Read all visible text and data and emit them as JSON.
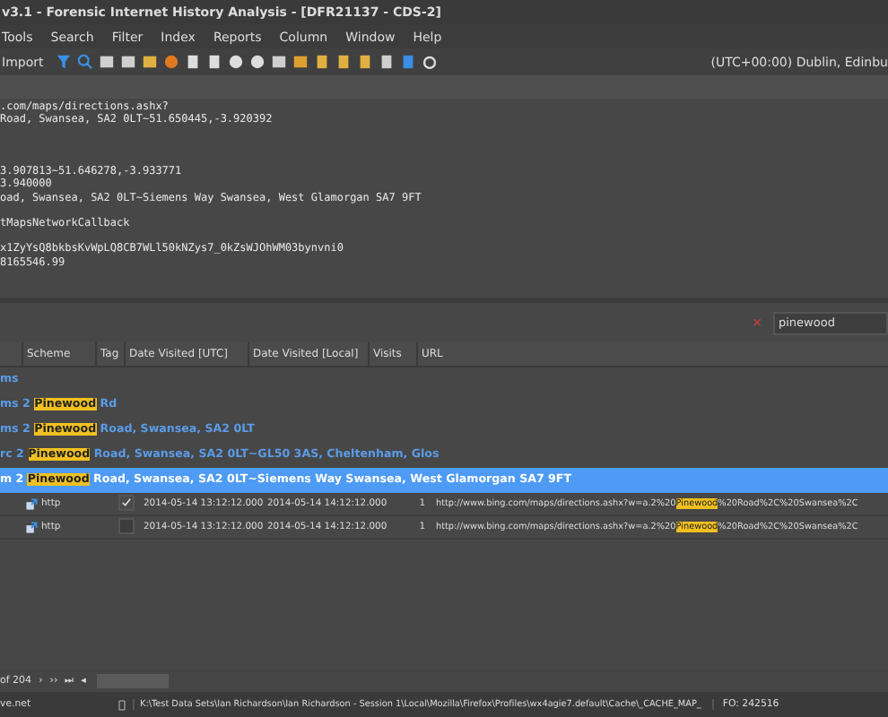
{
  "window": {
    "title": "v3.1 - Forensic Internet History Analysis - [DFR21137 - CDS-2]"
  },
  "menu": [
    "Tools",
    "Search",
    "Filter",
    "Index",
    "Reports",
    "Column",
    "Window",
    "Help"
  ],
  "toolbar": {
    "import_label": "Import",
    "timezone": "(UTC+00:00) Dublin, Edinbu"
  },
  "detail_blocks": [
    [
      ".com/maps/directions.ashx?",
      "Road, Swansea, SA2 0LT~51.650445,-3.920392"
    ],
    [
      "3.907813~51.646278,-3.933771",
      "3.940000",
      "oad, Swansea, SA2 0LT~Siemens Way Swansea, West Glamorgan SA7 9FT"
    ],
    [
      "tMapsNetworkCallback"
    ],
    [
      "x1ZyYsQ8bkbsKvWpLQ8CB7WLl50kNZys7_0kZsWJOhWM03bynvni0",
      "8165546.99"
    ]
  ],
  "search": {
    "clear": "×",
    "value": "pinewood"
  },
  "table": {
    "columns": [
      "Scheme",
      "Tag",
      "Date Visited [UTC]",
      "Date Visited [Local]",
      "Visits",
      "URL"
    ],
    "groups": [
      {
        "prefix": "ms",
        "selected": false
      },
      {
        "prefix": "ms 2 ",
        "match": "Pinewood",
        "rest": " Rd",
        "selected": false
      },
      {
        "prefix": "ms 2 ",
        "match": "Pinewood",
        "rest": " Road, Swansea, SA2 0LT",
        "selected": false
      },
      {
        "prefix": "rc 2 ",
        "match": "Pinewood",
        "rest": " Road, Swansea, SA2 0LT~GL50 3AS, Cheltenham, Glos",
        "selected": false
      },
      {
        "prefix": "m 2 ",
        "match": "Pinewood",
        "rest": " Road, Swansea, SA2 0LT~Siemens Way Swansea, West Glamorgan SA7 9FT",
        "selected": true
      }
    ],
    "rows": [
      {
        "scheme": "http",
        "checked": true,
        "utc": "2014-05-14 13:12:12.000",
        "local": "2014-05-14 14:12:12.000",
        "visits": "1",
        "url_before": "http://www.bing.com/maps/directions.ashx?w=a.2%20",
        "match": "Pinewood",
        "url_after": "%20Road%2C%20Swansea%2C"
      },
      {
        "scheme": "http",
        "checked": false,
        "utc": "2014-05-14 13:12:12.000",
        "local": "2014-05-14 14:12:12.000",
        "visits": "1",
        "url_before": "http://www.bing.com/maps/directions.ashx?w=a.2%20",
        "match": "Pinewood",
        "url_after": "%20Road%2C%20Swansea%2C"
      }
    ]
  },
  "pager": {
    "label": "of 204",
    "nav": [
      "›",
      "››",
      "⏭",
      "◂"
    ]
  },
  "status_bar": {
    "left": "ve.net",
    "path": "K:\\Test Data Sets\\Ian Richardson\\Ian Richardson - Session 1\\Local\\Mozilla\\Firefox\\Profiles\\wx4agie7.default\\Cache\\_CACHE_MAP_",
    "offset": "FO: 242516"
  }
}
